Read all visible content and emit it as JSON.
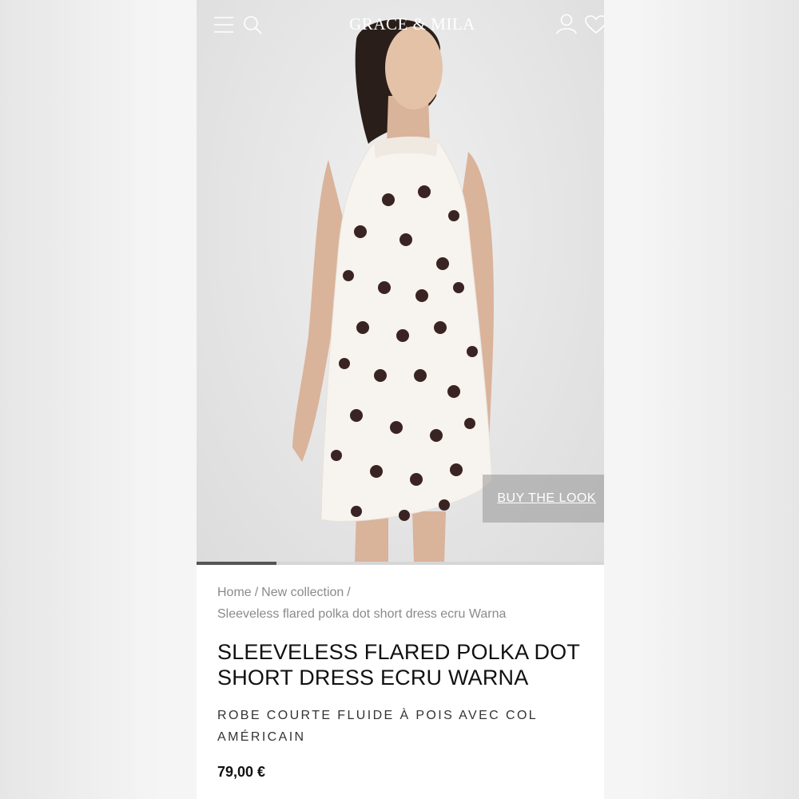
{
  "brand": {
    "logo_text": "GRACE & MILA",
    "accent_color": "#ffffff",
    "text_color": "#111111",
    "muted_text_color": "#8a8a8a"
  },
  "header": {
    "icons": [
      "menu-icon",
      "search-icon",
      "account-icon",
      "heart-icon"
    ]
  },
  "hero": {
    "image_subject": "model wearing polka dot dress",
    "buy_the_look_label": "BUY THE LOOK",
    "dress_color": "#f7f3ee",
    "dot_color": "#3a2423"
  },
  "breadcrumb": {
    "items": [
      "Home",
      "New collection",
      "Sleeveless flared polka dot short dress ecru Warna"
    ],
    "separator": "/"
  },
  "product": {
    "title": "SLEEVELESS FLARED POLKA DOT SHORT DRESS ECRU WARNA",
    "subtitle": "ROBE COURTE FLUIDE À POIS AVEC COL AMÉRICAIN",
    "price": "79,00 €"
  }
}
